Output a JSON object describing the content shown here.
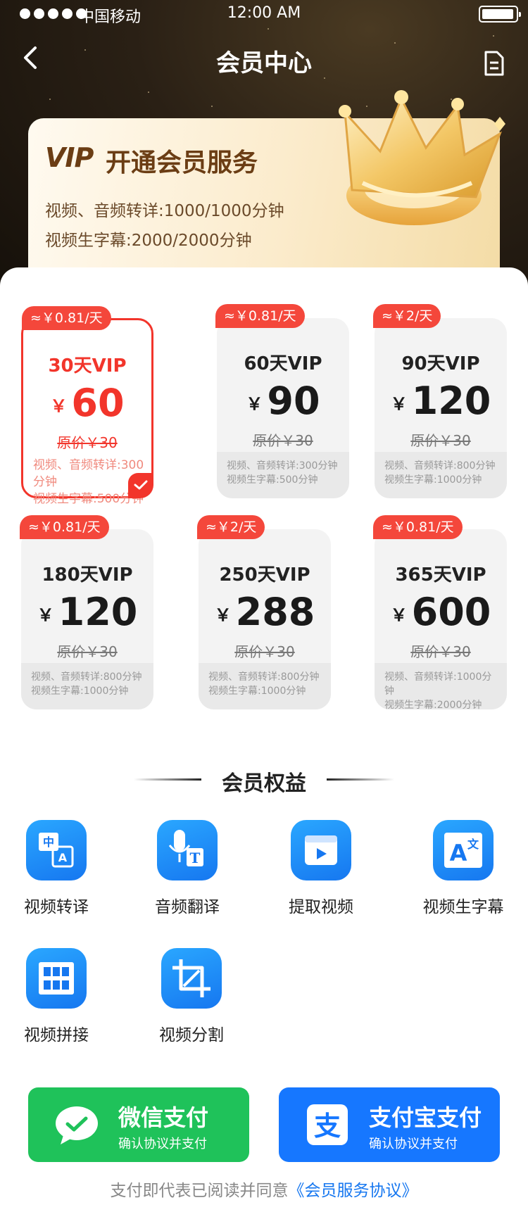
{
  "status": {
    "carrier": "中国移动",
    "time": "12:00 AM"
  },
  "nav": {
    "title": "会员中心",
    "back_icon": "back-chevron-icon",
    "doc_icon": "document-icon"
  },
  "vip": {
    "logo": "VIP",
    "title": "开通会员服务",
    "line1": "视频、音频转详:1000/1000分钟",
    "line2": "视频生字幕:2000/2000分钟"
  },
  "plans": [
    {
      "tag": "≈￥0.81/天",
      "name": "30天VIP",
      "currency": "￥",
      "price": "60",
      "orig": "原价￥30",
      "desc1": "视频、音频转详:300分钟",
      "desc2": "视频生字幕:500分钟",
      "selected": true
    },
    {
      "tag": "≈￥0.81/天",
      "name": "60天VIP",
      "currency": "￥",
      "price": "90",
      "orig": "原价￥30",
      "desc1": "视频、音频转详:300分钟",
      "desc2": "视频生字幕:500分钟"
    },
    {
      "tag": "≈￥2/天",
      "name": "90天VIP",
      "currency": "￥",
      "price": "120",
      "orig": "原价￥30",
      "desc1": "视频、音频转详:800分钟",
      "desc2": "视频生字幕:1000分钟"
    },
    {
      "tag": "≈￥0.81/天",
      "name": "180天VIP",
      "currency": "￥",
      "price": "120",
      "orig": "原价￥30",
      "desc1": "视频、音频转详:800分钟",
      "desc2": "视频生字幕:1000分钟"
    },
    {
      "tag": "≈￥2/天",
      "name": "250天VIP",
      "currency": "￥",
      "price": "288",
      "orig": "原价￥30",
      "desc1": "视频、音频转详:800分钟",
      "desc2": "视频生字幕:1000分钟"
    },
    {
      "tag": "≈￥0.81/天",
      "name": "365天VIP",
      "currency": "￥",
      "price": "600",
      "orig": "原价￥30",
      "desc1": "视频、音频转详:1000分钟",
      "desc2": "视频生字幕:2000分钟"
    }
  ],
  "benefits": {
    "title": "会员权益",
    "items": [
      {
        "label": "视频转译",
        "icon": "translate-icon"
      },
      {
        "label": "音频翻译",
        "icon": "microphone-text-icon"
      },
      {
        "label": "提取视频",
        "icon": "video-play-icon"
      },
      {
        "label": "视频生字幕",
        "icon": "subtitle-icon"
      },
      {
        "label": "视频拼接",
        "icon": "film-grid-icon"
      },
      {
        "label": "视频分割",
        "icon": "crop-icon"
      }
    ]
  },
  "pay": {
    "wechat": {
      "title": "微信支付",
      "sub": "确认协议并支付",
      "color": "#1fc25a"
    },
    "alipay": {
      "title": "支付宝支付",
      "sub": "确认协议并支付",
      "color": "#1677ff"
    }
  },
  "agreement": {
    "prefix": "支付即代表已阅读并同意",
    "link": "《会员服务协议》"
  },
  "colors": {
    "accent_red": "#f2352b",
    "brand_gold": "#6b3d14",
    "benefit_blue": "#1677f0"
  }
}
